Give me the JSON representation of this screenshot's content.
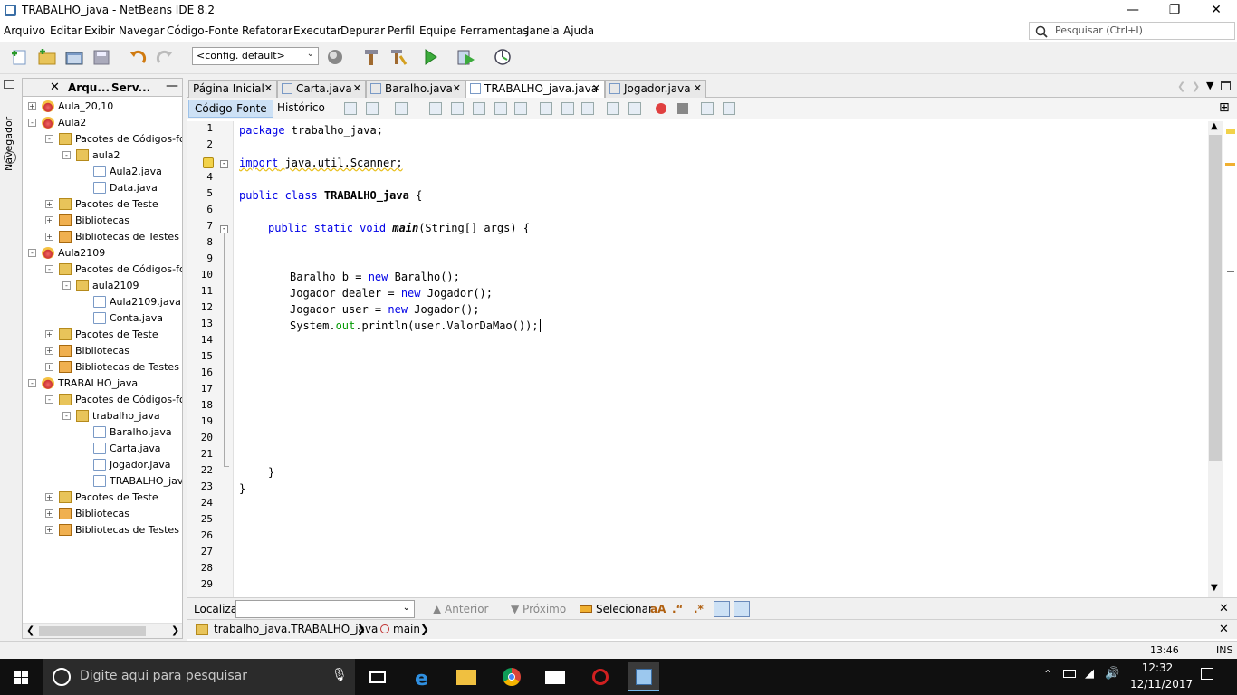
{
  "window": {
    "title": "TRABALHO_java - NetBeans IDE 8.2",
    "min": "—",
    "max": "❐",
    "close": "✕"
  },
  "menu": [
    "Arquivo",
    "Editar",
    "Exibir",
    "Navegar",
    "Código-Fonte",
    "Refatorar",
    "Executar",
    "Depurar",
    "Perfil",
    "Equipe",
    "Ferramentas",
    "Janela",
    "Ajuda"
  ],
  "search": {
    "placeholder": "Pesquisar (Ctrl+I)"
  },
  "toolbar": {
    "config": "<config. default>"
  },
  "navigator": {
    "label": "Navegador"
  },
  "projects": {
    "tabs": [
      "Arqu...",
      "Serv..."
    ],
    "tree": [
      {
        "label": "Aula_20,10",
        "icon": "project",
        "depth": 0,
        "exp": "+"
      },
      {
        "label": "Aula2",
        "icon": "project",
        "depth": 0,
        "exp": "-"
      },
      {
        "label": "Pacotes de Códigos-fon",
        "icon": "package-folder",
        "depth": 1,
        "exp": "-"
      },
      {
        "label": "aula2",
        "icon": "package",
        "depth": 2,
        "exp": "-"
      },
      {
        "label": "Aula2.java",
        "icon": "java-main",
        "depth": 3,
        "exp": ""
      },
      {
        "label": "Data.java",
        "icon": "java",
        "depth": 3,
        "exp": ""
      },
      {
        "label": "Pacotes de Teste",
        "icon": "package-folder",
        "depth": 1,
        "exp": "+"
      },
      {
        "label": "Bibliotecas",
        "icon": "library",
        "depth": 1,
        "exp": "+"
      },
      {
        "label": "Bibliotecas de Testes",
        "icon": "library",
        "depth": 1,
        "exp": "+"
      },
      {
        "label": "Aula2109",
        "icon": "project",
        "depth": 0,
        "exp": "-"
      },
      {
        "label": "Pacotes de Códigos-fon",
        "icon": "package-folder",
        "depth": 1,
        "exp": "-"
      },
      {
        "label": "aula2109",
        "icon": "package",
        "depth": 2,
        "exp": "-"
      },
      {
        "label": "Aula2109.java",
        "icon": "java-main",
        "depth": 3,
        "exp": ""
      },
      {
        "label": "Conta.java",
        "icon": "java",
        "depth": 3,
        "exp": ""
      },
      {
        "label": "Pacotes de Teste",
        "icon": "package-folder",
        "depth": 1,
        "exp": "+"
      },
      {
        "label": "Bibliotecas",
        "icon": "library",
        "depth": 1,
        "exp": "+"
      },
      {
        "label": "Bibliotecas de Testes",
        "icon": "library",
        "depth": 1,
        "exp": "+"
      },
      {
        "label": "TRABALHO_java",
        "icon": "project",
        "depth": 0,
        "exp": "-"
      },
      {
        "label": "Pacotes de Códigos-fon",
        "icon": "package-folder",
        "depth": 1,
        "exp": "-"
      },
      {
        "label": "trabalho_java",
        "icon": "package",
        "depth": 2,
        "exp": "-"
      },
      {
        "label": "Baralho.java",
        "icon": "java",
        "depth": 3,
        "exp": ""
      },
      {
        "label": "Carta.java",
        "icon": "java",
        "depth": 3,
        "exp": ""
      },
      {
        "label": "Jogador.java",
        "icon": "java",
        "depth": 3,
        "exp": ""
      },
      {
        "label": "TRABALHO_java.java",
        "icon": "java-main",
        "depth": 3,
        "exp": ""
      },
      {
        "label": "Pacotes de Teste",
        "icon": "package-folder",
        "depth": 1,
        "exp": "+"
      },
      {
        "label": "Bibliotecas",
        "icon": "library",
        "depth": 1,
        "exp": "+"
      },
      {
        "label": "Bibliotecas de Testes",
        "icon": "library",
        "depth": 1,
        "exp": "+"
      }
    ]
  },
  "editor": {
    "tabs": [
      {
        "label": "Página Inicial",
        "active": false
      },
      {
        "label": "Carta.java",
        "active": false
      },
      {
        "label": "Baralho.java",
        "active": false
      },
      {
        "label": "TRABALHO_java.java",
        "active": true
      },
      {
        "label": "Jogador.java",
        "active": false
      }
    ],
    "source_button": "Código-Fonte",
    "history_button": "Histórico",
    "line_numbers": [
      "1",
      "2",
      "3",
      "4",
      "5",
      "6",
      "7",
      "8",
      "9",
      "10",
      "11",
      "12",
      "13",
      "14",
      "15",
      "16",
      "17",
      "18",
      "19",
      "20",
      "21",
      "22",
      "23",
      "24",
      "25",
      "26",
      "27",
      "28",
      "29"
    ],
    "code": {
      "l1_kw": "package",
      "l1_rest": " trabalho_java;",
      "l3_kw": "import",
      "l3_rest": " java.util.Scanner;",
      "l5_kw": "public class",
      "l5_name": " TRABALHO_java",
      "l5_rest": " {",
      "l7_kw": "public static void",
      "l7_name": "main",
      "l7_rest": "(String[] args) {",
      "l10_a": "Baralho b = ",
      "l10_kw": "new",
      "l10_b": " Baralho();",
      "l11_a": "Jogador dealer = ",
      "l11_kw": "new",
      "l11_b": " Jogador();",
      "l12_a": "Jogador user = ",
      "l12_kw": "new",
      "l12_b": " Jogador();",
      "l13_a": "System.",
      "l13_fld": "out",
      "l13_b": ".println(user.ValorDaMao());",
      "l22": "}",
      "l23": "}"
    }
  },
  "find": {
    "label": "Localizar:",
    "previous": "Anterior",
    "next": "Próximo",
    "select": "Selecionar"
  },
  "breadcrumb": {
    "class_path": "trabalho_java.TRABALHO_java",
    "method": "main"
  },
  "status": {
    "position": "13:46",
    "mode": "INS"
  },
  "taskbar": {
    "search_placeholder": "Digite aqui para pesquisar",
    "time": "12:32",
    "date": "12/11/2017"
  }
}
